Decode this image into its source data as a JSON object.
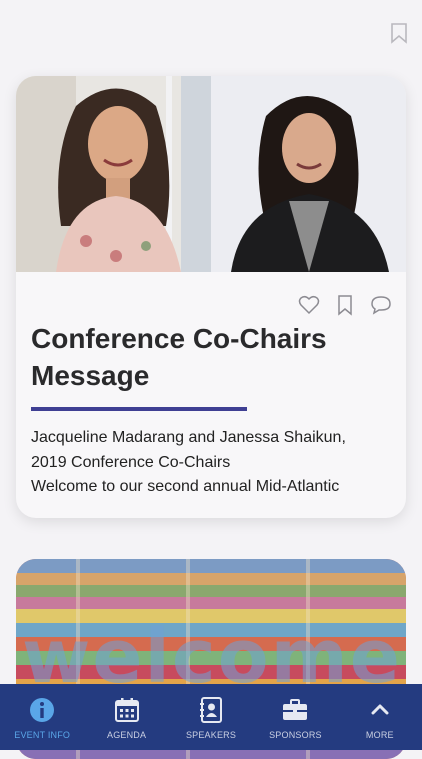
{
  "card": {
    "title": "Conference Co-Chairs Message",
    "body_line1": "Jacqueline Madarang and Janessa Shaikun,",
    "body_line2": "2019 Conference Co-Chairs",
    "body_line3": "Welcome to our second annual Mid-Atlantic"
  },
  "second_card": {
    "mural_text": "welcome"
  },
  "tabs": [
    {
      "label": "EVENT INFO",
      "icon": "info-icon",
      "active": true
    },
    {
      "label": "AGENDA",
      "icon": "calendar-icon",
      "active": false
    },
    {
      "label": "SPEAKERS",
      "icon": "contact-book-icon",
      "active": false
    },
    {
      "label": "SPONSORS",
      "icon": "briefcase-icon",
      "active": false
    },
    {
      "label": "MORE",
      "icon": "chevron-up-icon",
      "active": false
    }
  ],
  "colors": {
    "accent_rule": "#3f3f93",
    "tabbar_bg": "#243b80",
    "active_tab": "#5aa6e8"
  }
}
